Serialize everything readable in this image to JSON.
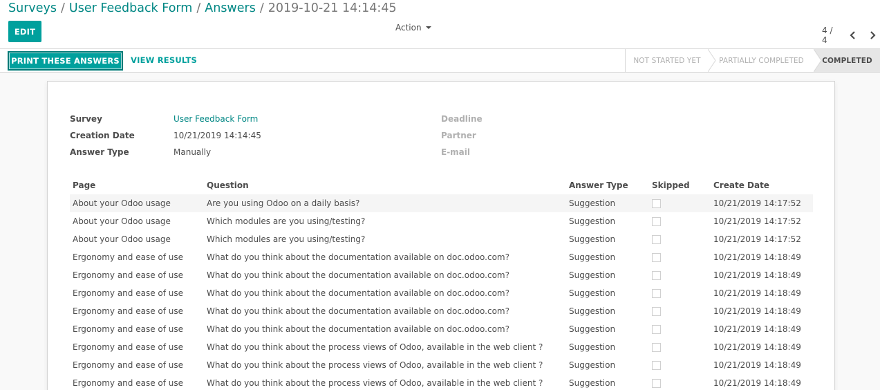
{
  "breadcrumb": {
    "items": [
      "Surveys",
      "User Feedback Form",
      "Answers"
    ],
    "separator": "/",
    "current": "2019-10-21 14:14:45"
  },
  "toolbar": {
    "edit_label": "EDIT",
    "action_label": "Action",
    "pager": "4 / 4"
  },
  "header_buttons": {
    "print_label": "PRINT THESE ANSWERS",
    "view_results_label": "VIEW RESULTS"
  },
  "stages": [
    {
      "label": "NOT STARTED YET",
      "active": false
    },
    {
      "label": "PARTIALLY COMPLETED",
      "active": false
    },
    {
      "label": "COMPLETED",
      "active": true
    }
  ],
  "fields": {
    "survey_label": "Survey",
    "survey_value": "User Feedback Form",
    "creation_date_label": "Creation Date",
    "creation_date_value": "10/21/2019 14:14:45",
    "answer_type_label": "Answer Type",
    "answer_type_value": "Manually",
    "deadline_label": "Deadline",
    "partner_label": "Partner",
    "email_label": "E-mail"
  },
  "table": {
    "columns": [
      "Page",
      "Question",
      "Answer Type",
      "Skipped",
      "Create Date"
    ],
    "rows": [
      {
        "page": "About your Odoo usage",
        "question": "Are you using Odoo on a daily basis?",
        "answer_type": "Suggestion",
        "skipped": false,
        "create_date": "10/21/2019 14:17:52"
      },
      {
        "page": "About your Odoo usage",
        "question": "Which modules are you using/testing?",
        "answer_type": "Suggestion",
        "skipped": false,
        "create_date": "10/21/2019 14:17:52"
      },
      {
        "page": "About your Odoo usage",
        "question": "Which modules are you using/testing?",
        "answer_type": "Suggestion",
        "skipped": false,
        "create_date": "10/21/2019 14:17:52"
      },
      {
        "page": "Ergonomy and ease of use",
        "question": "What do you think about the documentation available on doc.odoo.com?",
        "answer_type": "Suggestion",
        "skipped": false,
        "create_date": "10/21/2019 14:18:49"
      },
      {
        "page": "Ergonomy and ease of use",
        "question": "What do you think about the documentation available on doc.odoo.com?",
        "answer_type": "Suggestion",
        "skipped": false,
        "create_date": "10/21/2019 14:18:49"
      },
      {
        "page": "Ergonomy and ease of use",
        "question": "What do you think about the documentation available on doc.odoo.com?",
        "answer_type": "Suggestion",
        "skipped": false,
        "create_date": "10/21/2019 14:18:49"
      },
      {
        "page": "Ergonomy and ease of use",
        "question": "What do you think about the documentation available on doc.odoo.com?",
        "answer_type": "Suggestion",
        "skipped": false,
        "create_date": "10/21/2019 14:18:49"
      },
      {
        "page": "Ergonomy and ease of use",
        "question": "What do you think about the documentation available on doc.odoo.com?",
        "answer_type": "Suggestion",
        "skipped": false,
        "create_date": "10/21/2019 14:18:49"
      },
      {
        "page": "Ergonomy and ease of use",
        "question": "What do you think about the process views of Odoo, available in the web client ?",
        "answer_type": "Suggestion",
        "skipped": false,
        "create_date": "10/21/2019 14:18:49"
      },
      {
        "page": "Ergonomy and ease of use",
        "question": "What do you think about the process views of Odoo, available in the web client ?",
        "answer_type": "Suggestion",
        "skipped": false,
        "create_date": "10/21/2019 14:18:49"
      },
      {
        "page": "Ergonomy and ease of use",
        "question": "What do you think about the process views of Odoo, available in the web client ?",
        "answer_type": "Suggestion",
        "skipped": false,
        "create_date": "10/21/2019 14:18:49"
      }
    ]
  },
  "icons": {
    "action_caret": "caret-down-icon",
    "pager_prev": "chevron-left-icon",
    "pager_next": "chevron-right-icon",
    "skipped": "checkbox-icon"
  },
  "colors": {
    "primary": "#00a09d",
    "link": "#008784",
    "muted": "#b0b0b0",
    "active_stage_bg": "#e6e6e6"
  }
}
